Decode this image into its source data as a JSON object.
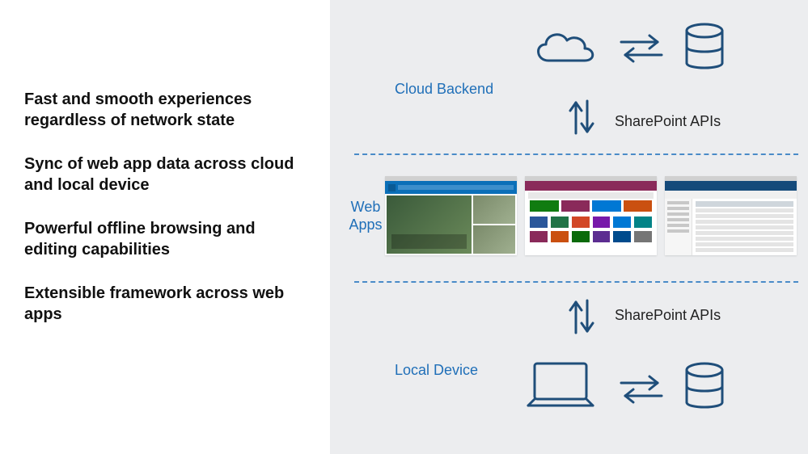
{
  "left_panel": {
    "bullets": [
      "Fast and smooth experiences regardless of network state",
      "Sync of web app data across cloud and local device",
      "Powerful offline browsing and editing capabilities",
      "Extensible framework across web apps"
    ]
  },
  "diagram": {
    "cloud_label": "Cloud Backend",
    "web_apps_label": "Web Apps",
    "local_label": "Local Device",
    "api_label_top": "SharePoint APIs",
    "api_label_bottom": "SharePoint APIs",
    "icons": {
      "cloud": "cloud-icon",
      "sync": "sync-arrows-icon",
      "database": "database-icon",
      "updown": "up-down-arrows-icon",
      "laptop": "laptop-icon"
    },
    "colors": {
      "label_blue": "#1f6fb8",
      "stroke_blue": "#1f4e7a",
      "panel_bg": "#ecedef"
    }
  }
}
